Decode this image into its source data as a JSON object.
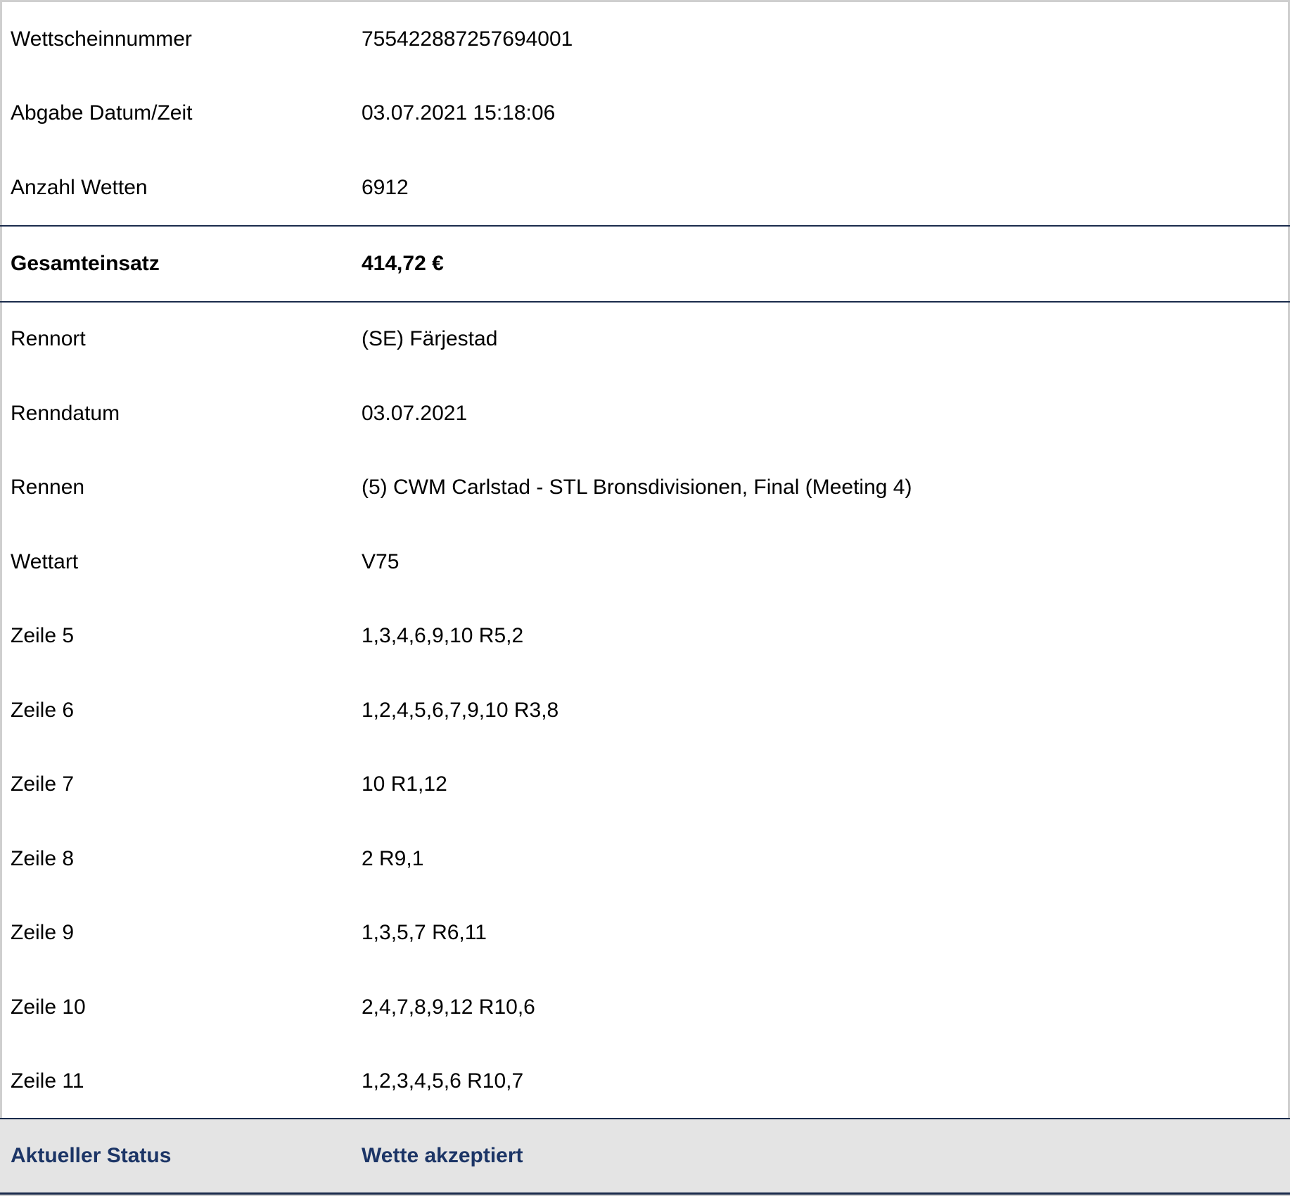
{
  "ticket": {
    "header_rows": [
      {
        "label": "Wettscheinnummer",
        "value": "755422887257694001"
      },
      {
        "label": "Abgabe Datum/Zeit",
        "value": "03.07.2021 15:18:06"
      },
      {
        "label": "Anzahl Wetten",
        "value": "6912"
      }
    ],
    "total": {
      "label": "Gesamteinsatz",
      "value": "414,72 €"
    },
    "detail_rows": [
      {
        "label": "Rennort",
        "value": "(SE) Färjestad"
      },
      {
        "label": "Renndatum",
        "value": "03.07.2021"
      },
      {
        "label": "Rennen",
        "value": "(5) CWM Carlstad - STL Bronsdivisionen, Final (Meeting 4)"
      },
      {
        "label": "Wettart",
        "value": "V75"
      },
      {
        "label": "Zeile 5",
        "value": "1,3,4,6,9,10 R5,2"
      },
      {
        "label": "Zeile 6",
        "value": "1,2,4,5,6,7,9,10 R3,8"
      },
      {
        "label": "Zeile 7",
        "value": "10 R1,12"
      },
      {
        "label": "Zeile 8",
        "value": "2 R9,1"
      },
      {
        "label": "Zeile 9",
        "value": "1,3,5,7 R6,11"
      },
      {
        "label": "Zeile 10",
        "value": "2,4,7,8,9,12 R10,6"
      },
      {
        "label": "Zeile 11",
        "value": "1,2,3,4,5,6 R10,7"
      }
    ],
    "status": {
      "label": "Aktueller Status",
      "value": "Wette akzeptiert"
    }
  },
  "colors": {
    "status_text": "#1c3566",
    "status_background": "#e4e4e4",
    "divider": "#1a2b4c"
  }
}
